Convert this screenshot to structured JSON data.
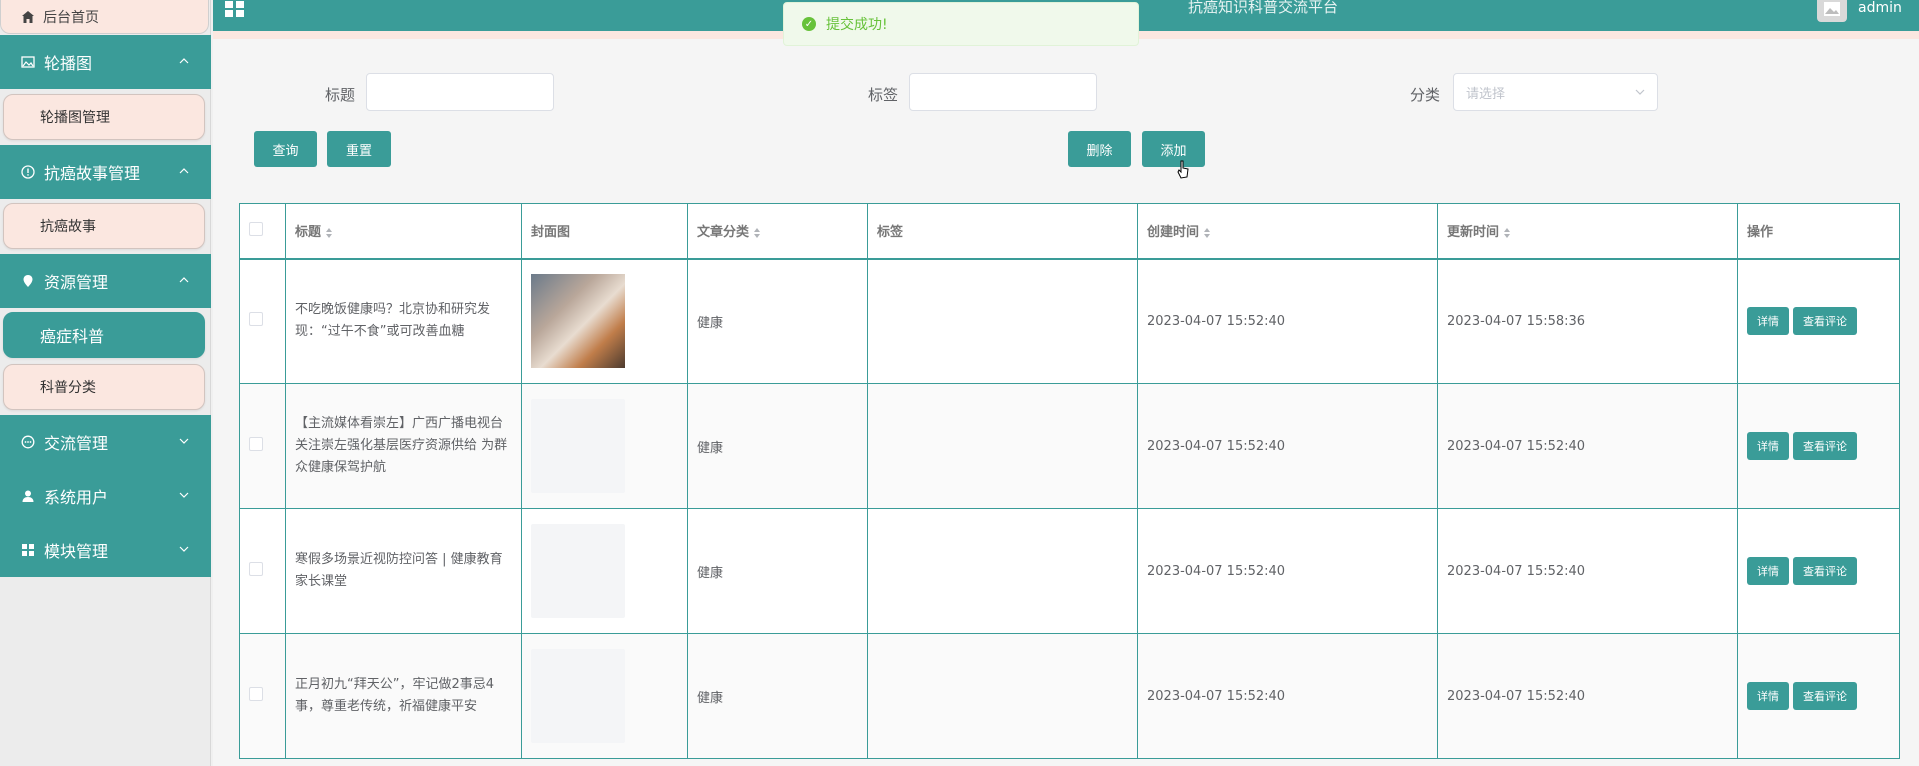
{
  "app": {
    "title": "抗癌知识科普交流平台",
    "user": "admin"
  },
  "toast": {
    "message": "提交成功!",
    "color": "#67c23a"
  },
  "theme": {
    "primary": "#3a9c98",
    "sub_bg": "#fbe7e0"
  },
  "sidebar": {
    "home": "后台首页",
    "groups": [
      {
        "label": "轮播图",
        "icon": "image-icon",
        "items": [
          "轮播图管理"
        ]
      },
      {
        "label": "抗癌故事管理",
        "icon": "info-circle-icon",
        "items": [
          "抗癌故事"
        ]
      },
      {
        "label": "资源管理",
        "icon": "location-icon",
        "items": [
          "癌症科普",
          "科普分类"
        ]
      },
      {
        "label": "交流管理",
        "icon": "chat-icon",
        "items": []
      },
      {
        "label": "系统用户",
        "icon": "user-icon",
        "items": []
      },
      {
        "label": "模块管理",
        "icon": "grid-icon",
        "items": []
      }
    ],
    "active": "癌症科普"
  },
  "filters": {
    "title_label": "标题",
    "tag_label": "标签",
    "category_label": "分类",
    "category_placeholder": "请选择",
    "title_value": "",
    "tag_value": ""
  },
  "buttons": {
    "query": "查询",
    "reset": "重置",
    "delete": "删除",
    "add": "添加"
  },
  "table": {
    "headers": [
      "标题",
      "封面图",
      "文章分类",
      "标签",
      "创建时间",
      "更新时间",
      "操作"
    ],
    "rows": [
      {
        "title": "不吃晚饭健康吗？北京协和研究发现：“过午不食”或可改善血糖",
        "category": "健康",
        "tag": "",
        "created": "2023-04-07 15:52:40",
        "updated": "2023-04-07 15:58:36"
      },
      {
        "title": "【主流媒体看崇左】广西广播电视台关注崇左强化基层医疗资源供给 为群众健康保驾护航",
        "category": "健康",
        "tag": "",
        "created": "2023-04-07 15:52:40",
        "updated": "2023-04-07 15:52:40"
      },
      {
        "title": "寒假多场景近视防控问答 | 健康教育家长课堂",
        "category": "健康",
        "tag": "",
        "created": "2023-04-07 15:52:40",
        "updated": "2023-04-07 15:52:40"
      },
      {
        "title": "正月初九“拜天公”，牢记做2事忌4事，尊重老传统，祈福健康平安",
        "category": "健康",
        "tag": "",
        "created": "2023-04-07 15:52:40",
        "updated": "2023-04-07 15:52:40"
      }
    ],
    "actions": {
      "detail": "详情",
      "comments": "查看评论"
    }
  }
}
